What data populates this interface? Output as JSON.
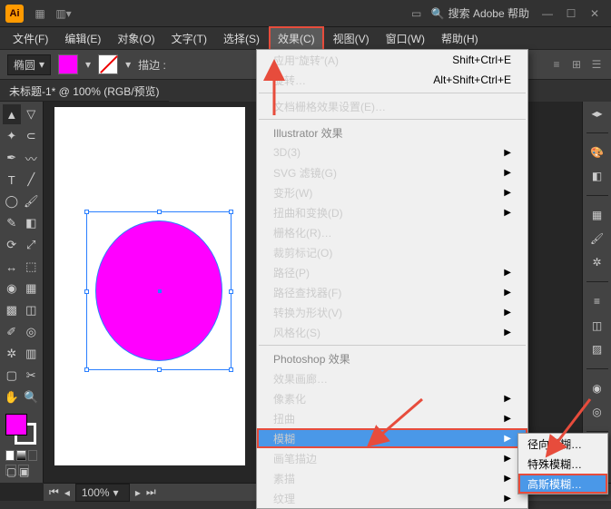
{
  "titlebar": {
    "logo": "Ai",
    "search_label": "搜索 Adobe 帮助"
  },
  "menubar": [
    "文件(F)",
    "编辑(E)",
    "对象(O)",
    "文字(T)",
    "选择(S)",
    "效果(C)",
    "视图(V)",
    "窗口(W)",
    "帮助(H)"
  ],
  "active_menu_index": 5,
  "ctrlbar": {
    "shape": "椭圆",
    "label_stroke": "描边 :"
  },
  "doc_tab": "未标题-1* @ 100% (RGB/预览)",
  "statusbar": {
    "zoom": "100%"
  },
  "dropdown": {
    "items": [
      {
        "t": "item",
        "label": "应用“旋转”(A)",
        "shortcut": "Shift+Ctrl+E"
      },
      {
        "t": "item",
        "label": "旋转…",
        "shortcut": "Alt+Shift+Ctrl+E"
      },
      {
        "t": "sep"
      },
      {
        "t": "item",
        "label": "文档栅格效果设置(E)…"
      },
      {
        "t": "sep"
      },
      {
        "t": "head",
        "label": "Illustrator 效果"
      },
      {
        "t": "item",
        "label": "3D(3)",
        "sub": true
      },
      {
        "t": "item",
        "label": "SVG 滤镜(G)",
        "sub": true
      },
      {
        "t": "item",
        "label": "变形(W)",
        "sub": true
      },
      {
        "t": "item",
        "label": "扭曲和变换(D)",
        "sub": true
      },
      {
        "t": "item",
        "label": "栅格化(R)…"
      },
      {
        "t": "item",
        "label": "裁剪标记(O)"
      },
      {
        "t": "item",
        "label": "路径(P)",
        "sub": true
      },
      {
        "t": "item",
        "label": "路径查找器(F)",
        "sub": true
      },
      {
        "t": "item",
        "label": "转换为形状(V)",
        "sub": true
      },
      {
        "t": "item",
        "label": "风格化(S)",
        "sub": true
      },
      {
        "t": "sep"
      },
      {
        "t": "head",
        "label": "Photoshop 效果"
      },
      {
        "t": "item",
        "label": "效果画廊…"
      },
      {
        "t": "item",
        "label": "像素化",
        "sub": true
      },
      {
        "t": "item",
        "label": "扭曲",
        "sub": true
      },
      {
        "t": "item",
        "label": "模糊",
        "sub": true,
        "hover": true
      },
      {
        "t": "item",
        "label": "画笔描边",
        "sub": true
      },
      {
        "t": "item",
        "label": "素描",
        "sub": true
      },
      {
        "t": "item",
        "label": "纹理",
        "sub": true
      }
    ]
  },
  "submenu": {
    "items": [
      {
        "label": "径向模糊…"
      },
      {
        "label": "特殊模糊…"
      },
      {
        "label": "高斯模糊…",
        "hover": true
      }
    ]
  }
}
